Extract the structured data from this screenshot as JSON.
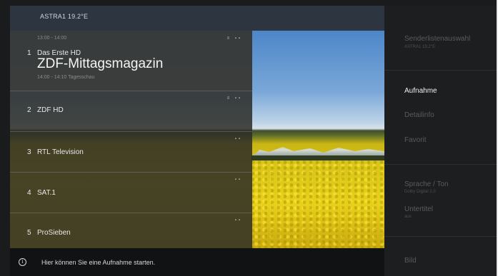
{
  "header": {
    "satellite": "ASTRA1 19.2°E"
  },
  "channels": [
    {
      "number": "1",
      "name": "Das Erste HD",
      "time": "13:00 - 14:00",
      "show": "ZDF-Mittagsmagazin",
      "next": "14:00 - 14:10   Tagesschau",
      "badges": "≡ ▪▪"
    },
    {
      "number": "2",
      "name": "ZDF HD",
      "badges": "≡ ▪▪"
    },
    {
      "number": "3",
      "name": "RTL Television",
      "badges": "▪▪"
    },
    {
      "number": "4",
      "name": "SAT.1",
      "badges": "▪▪"
    },
    {
      "number": "5",
      "name": "ProSieben",
      "badges": "▪▪"
    }
  ],
  "info": {
    "icon": "info-icon",
    "text": "Hier können Sie eine Aufnahme starten."
  },
  "menu": {
    "channel_list_label": "Senderlistenauswahl",
    "channel_list_value": "ASTRA1 19.2°E",
    "recording": "Aufnahme",
    "details": "Detailinfo",
    "favorite": "Favorit",
    "language_label": "Sprache / Ton",
    "language_value": "Dolby Digital 2.0",
    "subtitle_label": "Untertitel",
    "subtitle_value": "aus",
    "picture": "Bild"
  },
  "colors": {
    "accent_active": "#f0f0ee",
    "menu_bg": "#1d1e1f",
    "topbar_bg": "#2c3540"
  }
}
